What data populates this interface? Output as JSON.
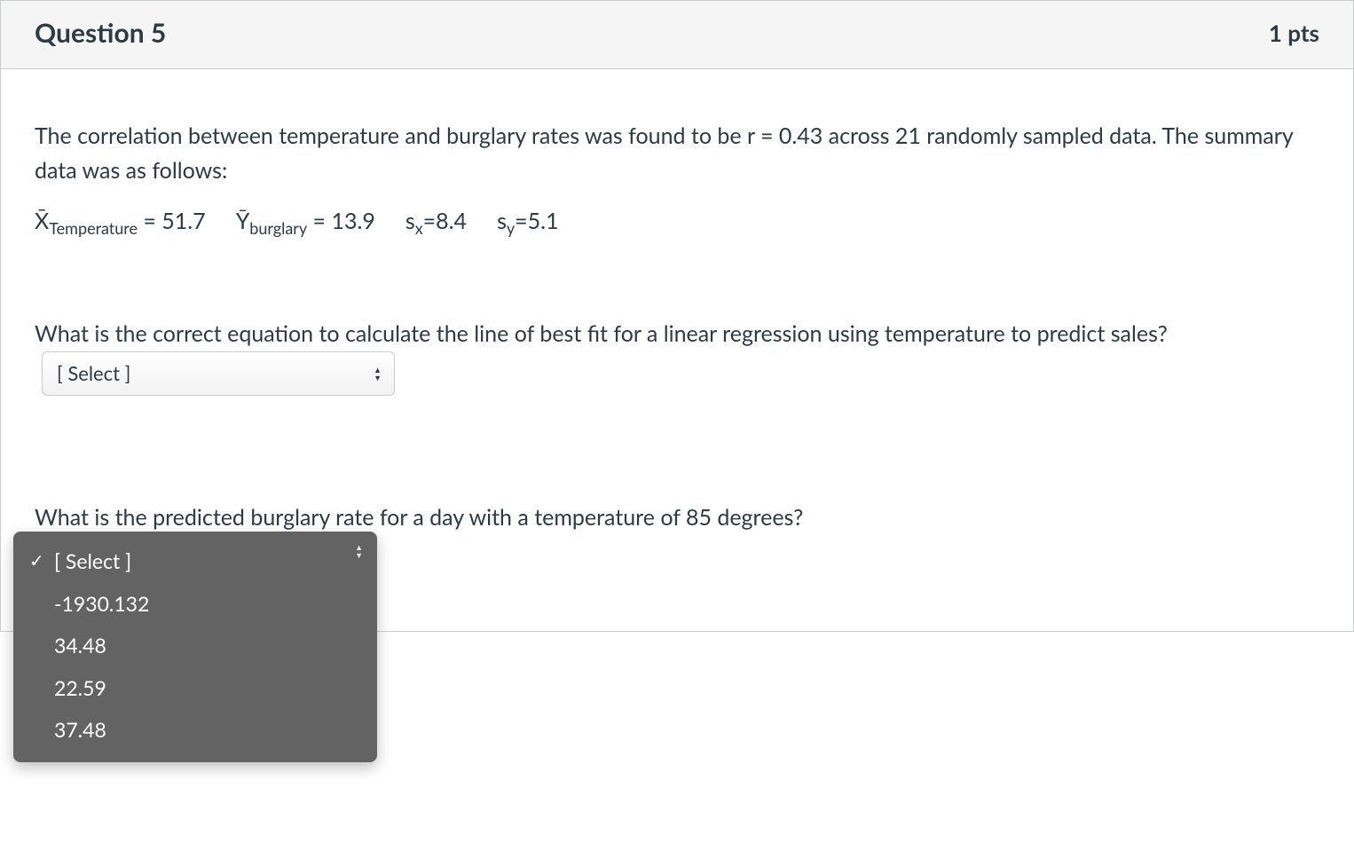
{
  "header": {
    "title": "Question 5",
    "points": "1 pts"
  },
  "intro": {
    "line1": "The correlation between temperature and burglary rates was found to be r = 0.43 across 21 randomly sampled data. The summary data was as follows:"
  },
  "stats": {
    "xbar_label_prefix": "X̄",
    "xbar_sub": "Temperature",
    "xbar_value": " = 51.7",
    "ybar_label_prefix": "Ȳ",
    "ybar_sub": "burglary",
    "ybar_value": " = 13.9",
    "sx_label": "s",
    "sx_sub": "x",
    "sx_value": "=8.4",
    "sy_label": "s",
    "sy_sub": "y",
    "sy_value": "=5.1"
  },
  "q2": {
    "text": "What is the correct equation to calculate the line of best fit for a linear regression using temperature to predict sales?",
    "select_placeholder": "[ Select ]"
  },
  "q3": {
    "text": "What is the predicted burglary rate for a day with a temperature of 85 degrees?",
    "select_placeholder": "[ Select ]",
    "options": [
      "[ Select ]",
      "-1930.132",
      "34.48",
      "22.59",
      "37.48"
    ],
    "selected_index": 0
  }
}
